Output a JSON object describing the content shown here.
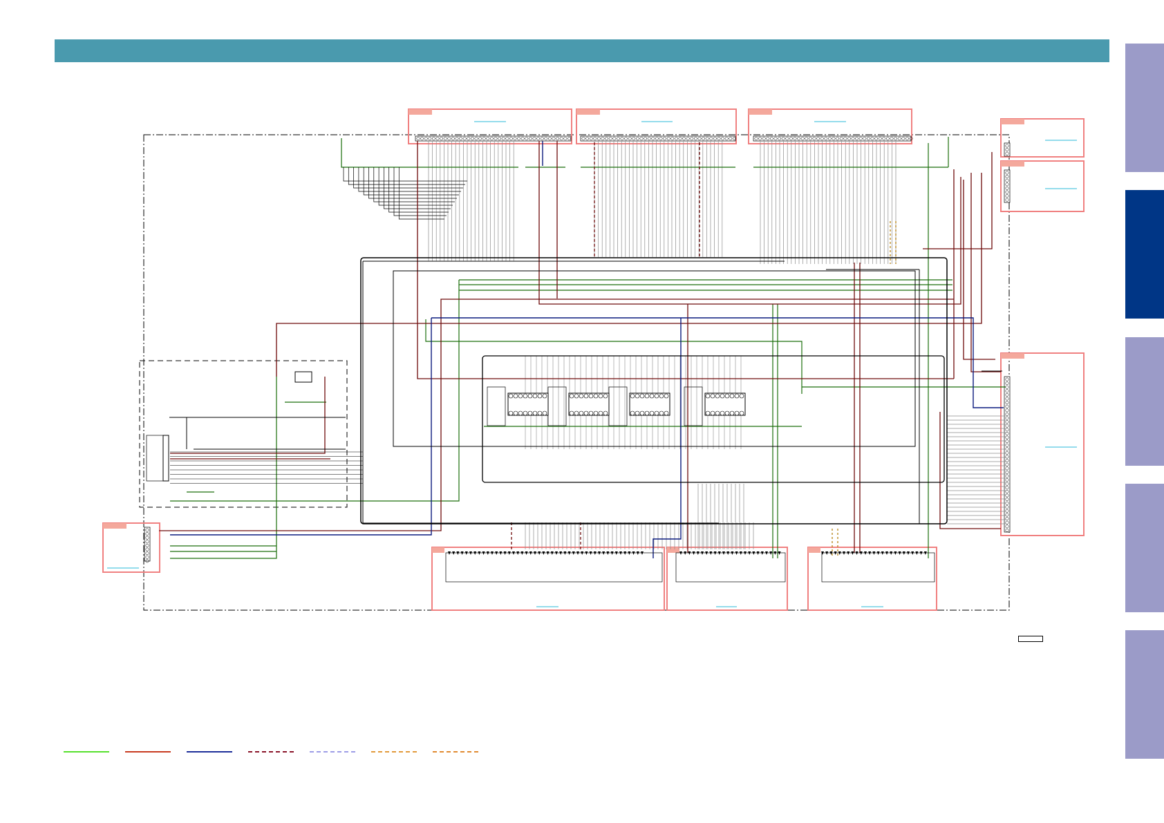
{
  "page": {
    "header_color": "#4a9aae",
    "background": "#ffffff"
  },
  "side_tabs": [
    {
      "name": "tab-1",
      "active": false,
      "color": "#9b9bc8"
    },
    {
      "name": "tab-2",
      "active": true,
      "color": "#003686"
    },
    {
      "name": "tab-3",
      "active": false,
      "color": "#9b9bc8"
    },
    {
      "name": "tab-4",
      "active": false,
      "color": "#9b9bc8"
    },
    {
      "name": "tab-5",
      "active": false,
      "color": "#9b9bc8"
    }
  ],
  "colors": {
    "connector_box": "#f08080",
    "connector_tag": "#f4a89c",
    "link_line": "#29b8d8",
    "wire_green": "#1a6e0a",
    "wire_red": "#6e0a0a",
    "wire_blue": "#0a1a7e",
    "wire_black": "#000000",
    "wire_grey": "#8c8c8c",
    "dash_orange": "#b07800"
  },
  "legend": [
    {
      "name": "legend-line-green",
      "color": "#55e02c",
      "style": "solid"
    },
    {
      "name": "legend-line-red",
      "color": "#c83a20",
      "style": "solid"
    },
    {
      "name": "legend-line-blue",
      "color": "#1d2e9a",
      "style": "solid"
    },
    {
      "name": "legend-line-dark-red-dashed",
      "color": "#8a1428",
      "style": "dashed"
    },
    {
      "name": "legend-line-lavender-dashed",
      "color": "#9c9ce6",
      "style": "dashed"
    },
    {
      "name": "legend-line-orange-dashed",
      "color": "#e29a3a",
      "style": "dashed"
    },
    {
      "name": "legend-line-orange-dashed-2",
      "color": "#e08a30",
      "style": "dashed"
    }
  ]
}
